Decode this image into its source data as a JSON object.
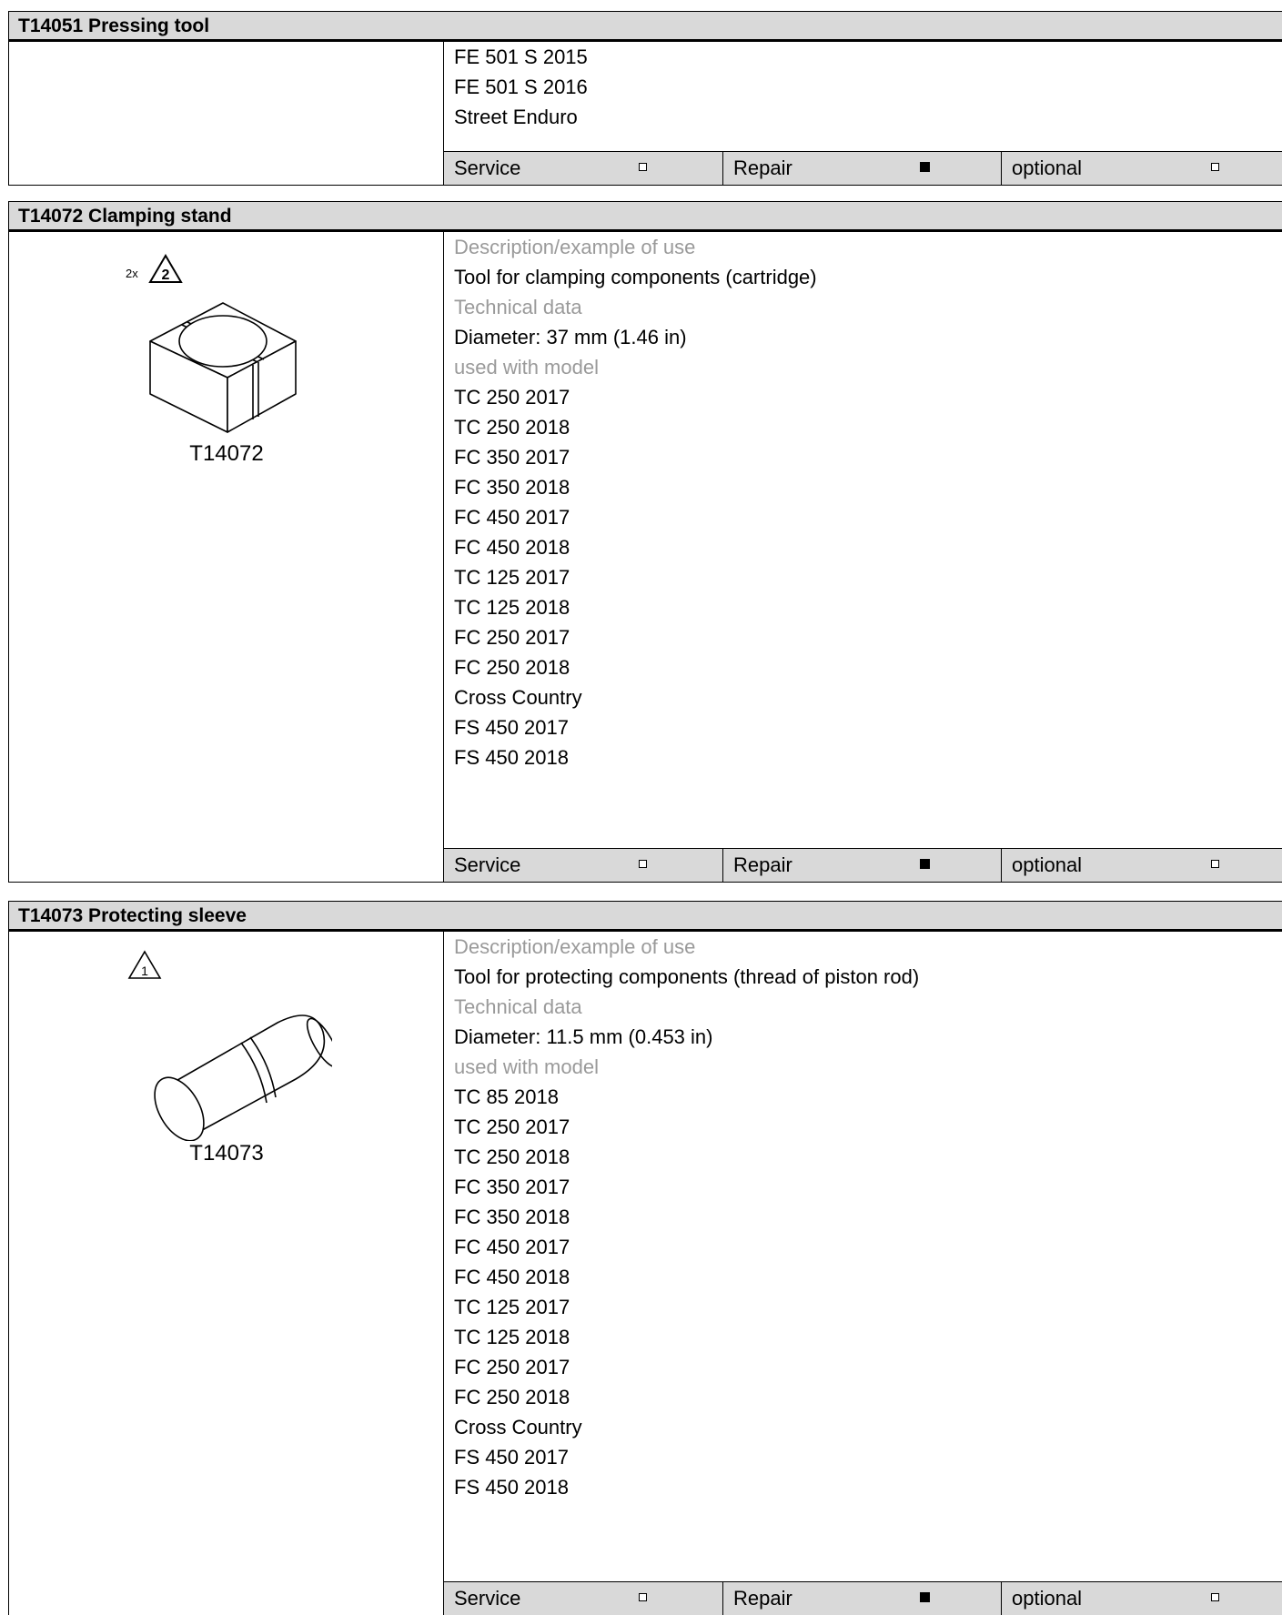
{
  "tools": [
    {
      "title": "T14051 Pressing tool",
      "lines": [
        {
          "text": "FE 501 S 2015",
          "style": "normal"
        },
        {
          "text": "FE 501 S 2016",
          "style": "normal"
        },
        {
          "text": "Street Enduro",
          "style": "normal"
        }
      ],
      "footer": {
        "service": {
          "label": "Service",
          "checked": false
        },
        "repair": {
          "label": "Repair",
          "checked": true
        },
        "optional": {
          "label": "optional",
          "checked": false
        }
      }
    },
    {
      "title": "T14072 Clamping stand",
      "image_code": "T14072",
      "warning": {
        "multiplier": "2x",
        "number": "2"
      },
      "lines": [
        {
          "text": "Description/example of use",
          "style": "gray"
        },
        {
          "text": "Tool for clamping components (cartridge)",
          "style": "normal"
        },
        {
          "text": "Technical data",
          "style": "gray"
        },
        {
          "text": "Diameter: 37 mm (1.46 in)",
          "style": "normal"
        },
        {
          "text": "used with model",
          "style": "gray"
        },
        {
          "text": "TC 250 2017",
          "style": "normal"
        },
        {
          "text": "TC 250 2018",
          "style": "normal"
        },
        {
          "text": "FC 350 2017",
          "style": "normal"
        },
        {
          "text": "FC 350 2018",
          "style": "normal"
        },
        {
          "text": "FC 450 2017",
          "style": "normal"
        },
        {
          "text": "FC 450 2018",
          "style": "normal"
        },
        {
          "text": "TC 125 2017",
          "style": "normal"
        },
        {
          "text": "TC 125 2018",
          "style": "normal"
        },
        {
          "text": "FC 250 2017",
          "style": "normal"
        },
        {
          "text": "FC 250 2018",
          "style": "normal"
        },
        {
          "text": "Cross Country",
          "style": "normal"
        },
        {
          "text": "FS 450 2017",
          "style": "normal"
        },
        {
          "text": "FS 450 2018",
          "style": "normal"
        }
      ],
      "footer": {
        "service": {
          "label": "Service",
          "checked": false
        },
        "repair": {
          "label": "Repair",
          "checked": true
        },
        "optional": {
          "label": "optional",
          "checked": false
        }
      }
    },
    {
      "title": "T14073 Protecting sleeve",
      "image_code": "T14073",
      "warning": {
        "multiplier": "",
        "number": "1"
      },
      "lines": [
        {
          "text": "Description/example of use",
          "style": "gray"
        },
        {
          "text": "Tool for protecting components (thread of piston rod)",
          "style": "normal"
        },
        {
          "text": "Technical data",
          "style": "gray"
        },
        {
          "text": "Diameter: 11.5 mm (0.453 in)",
          "style": "normal"
        },
        {
          "text": "used with model",
          "style": "gray"
        },
        {
          "text": "TC 85 2018",
          "style": "normal"
        },
        {
          "text": "TC 250 2017",
          "style": "normal"
        },
        {
          "text": "TC 250 2018",
          "style": "normal"
        },
        {
          "text": "FC 350 2017",
          "style": "normal"
        },
        {
          "text": "FC 350 2018",
          "style": "normal"
        },
        {
          "text": "FC 450 2017",
          "style": "normal"
        },
        {
          "text": "FC 450 2018",
          "style": "normal"
        },
        {
          "text": "TC 125 2017",
          "style": "normal"
        },
        {
          "text": "TC 125 2018",
          "style": "normal"
        },
        {
          "text": "FC 250 2017",
          "style": "normal"
        },
        {
          "text": "FC 250 2018",
          "style": "normal"
        },
        {
          "text": "Cross Country",
          "style": "normal"
        },
        {
          "text": "FS 450 2017",
          "style": "normal"
        },
        {
          "text": "FS 450 2018",
          "style": "normal"
        }
      ],
      "footer": {
        "service": {
          "label": "Service",
          "checked": false
        },
        "repair": {
          "label": "Repair",
          "checked": true
        },
        "optional": {
          "label": "optional",
          "checked": false
        }
      }
    }
  ]
}
